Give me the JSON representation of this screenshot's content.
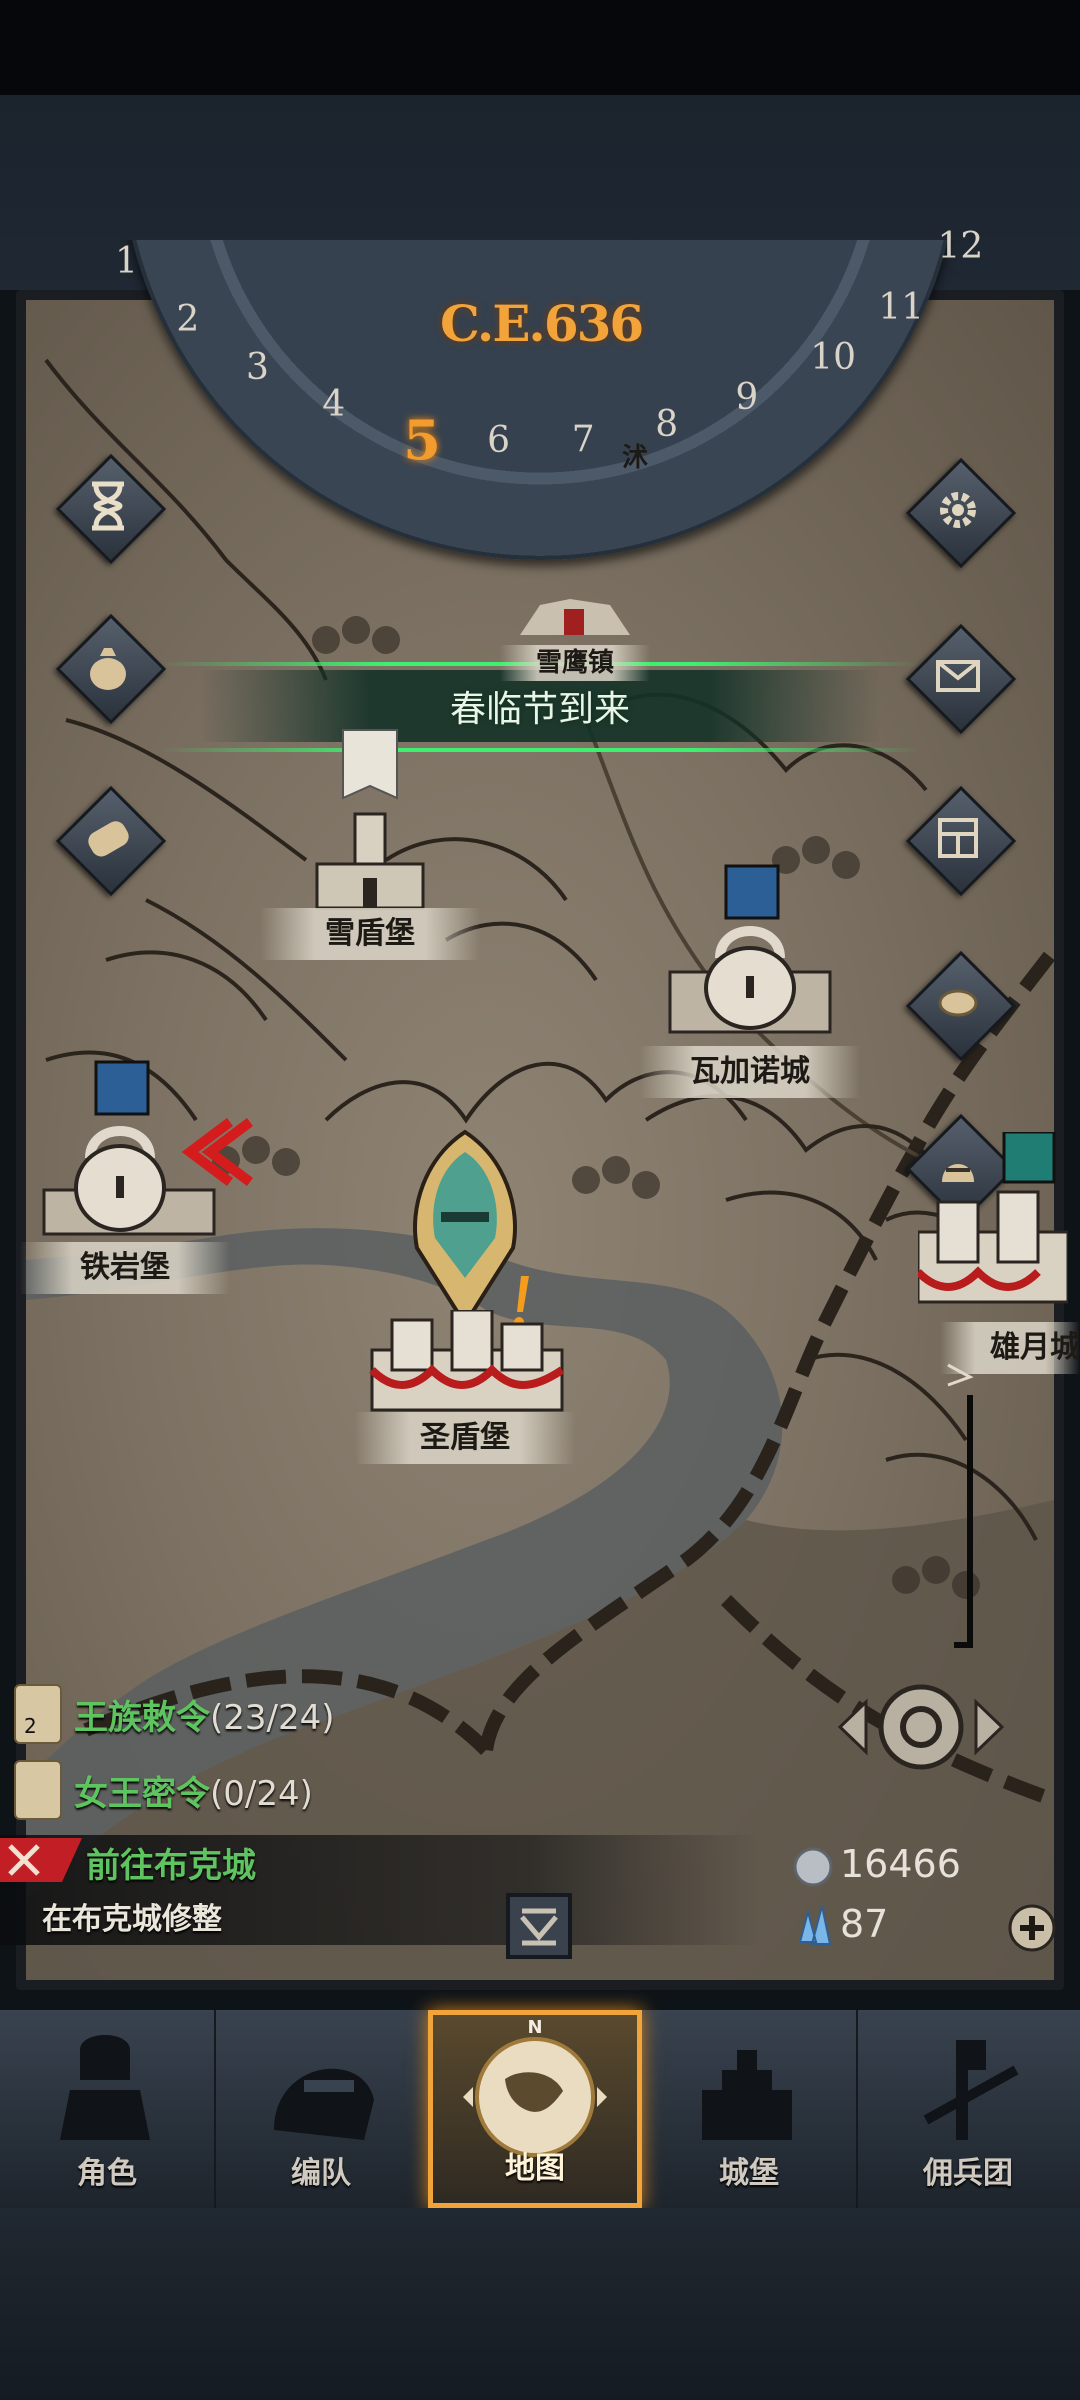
{
  "calendar": {
    "year": "C.E.636",
    "months": [
      "1",
      "2",
      "3",
      "4",
      "5",
      "6",
      "7",
      "8",
      "9",
      "10",
      "11",
      "12"
    ],
    "current_month": "5"
  },
  "event_banner": "春临节到来",
  "locations": {
    "snow_shield_fort": "雪盾堡",
    "snow_town_partial": "雪鹰镇",
    "top_town_partial": "沭",
    "vagano_city": "瓦加诺城",
    "iron_rock_fort": "铁岩堡",
    "holy_shield_fort": "圣盾堡",
    "moon_city": "雄月城"
  },
  "quests": [
    {
      "title": "王族敕令",
      "count": "(23/24)",
      "badge": "2"
    },
    {
      "title": "女王密令",
      "count": "(0/24)"
    }
  ],
  "task": {
    "title": "前往布克城",
    "subtitle": "在布克城修整"
  },
  "resources": {
    "silver": "16466",
    "crystal": "87"
  },
  "side_buttons_left": [
    "hourglass-icon",
    "money-bag-icon",
    "scroll-icon"
  ],
  "side_buttons_right": [
    "gear-icon",
    "mail-icon",
    "window-icon",
    "coin-icon",
    "knight-helmet-icon"
  ],
  "nav": {
    "items": [
      {
        "label": "角色",
        "icon": "knight-icon"
      },
      {
        "label": "编队",
        "icon": "helmet-icon"
      },
      {
        "label": "地图",
        "icon": "compass-map-icon"
      },
      {
        "label": "城堡",
        "icon": "castle-icon"
      },
      {
        "label": "佣兵团",
        "icon": "sword-banner-icon"
      }
    ],
    "active": "地图"
  },
  "colors": {
    "quest_green": "#5ec45f",
    "accent_orange": "#f0a43a",
    "banner_green": "#3ef070"
  }
}
